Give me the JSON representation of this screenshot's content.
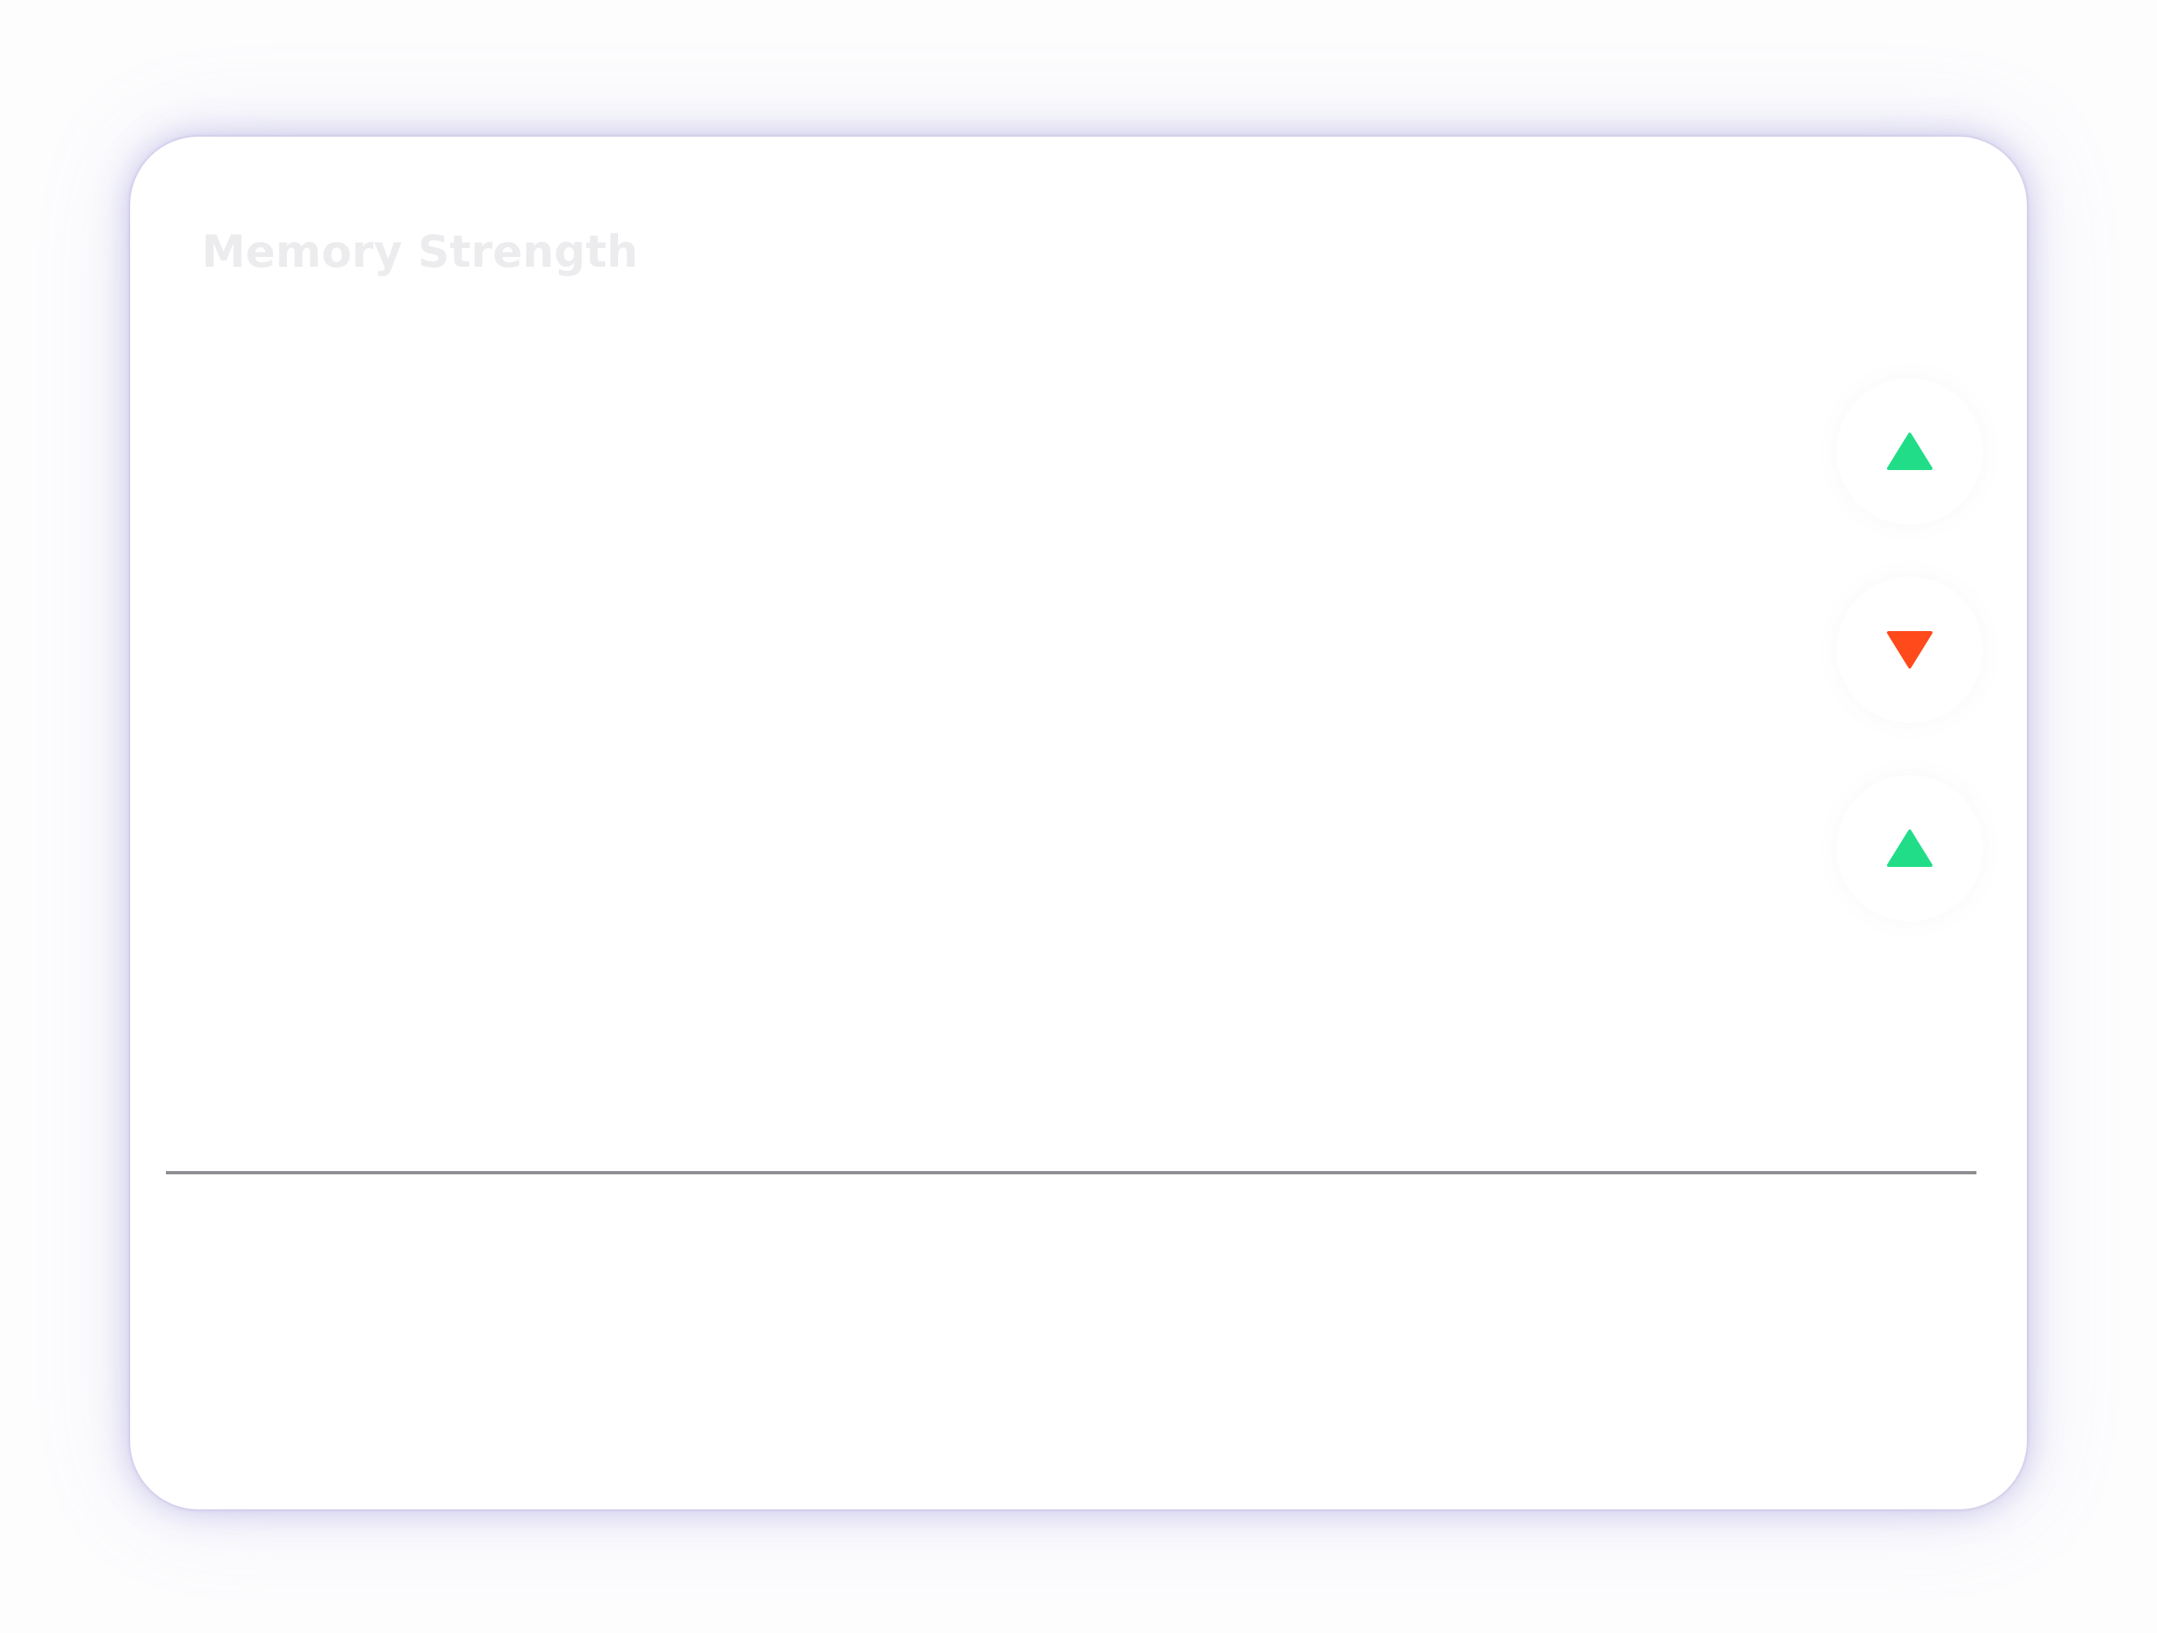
{
  "card": {
    "title": "Memory Strength"
  },
  "trend_indicators": [
    {
      "direction": "up",
      "icon": "triangle-up-icon",
      "color": "#22dd88"
    },
    {
      "direction": "down",
      "icon": "triangle-down-icon",
      "color": "#ff4a1c"
    },
    {
      "direction": "up",
      "icon": "triangle-up-icon",
      "color": "#22dd88"
    }
  ],
  "colors": {
    "up": "#22dd88",
    "down": "#ff4a1c",
    "baseline": "#8d8d92",
    "title": "#ececee",
    "glow": "#9c96d6"
  }
}
